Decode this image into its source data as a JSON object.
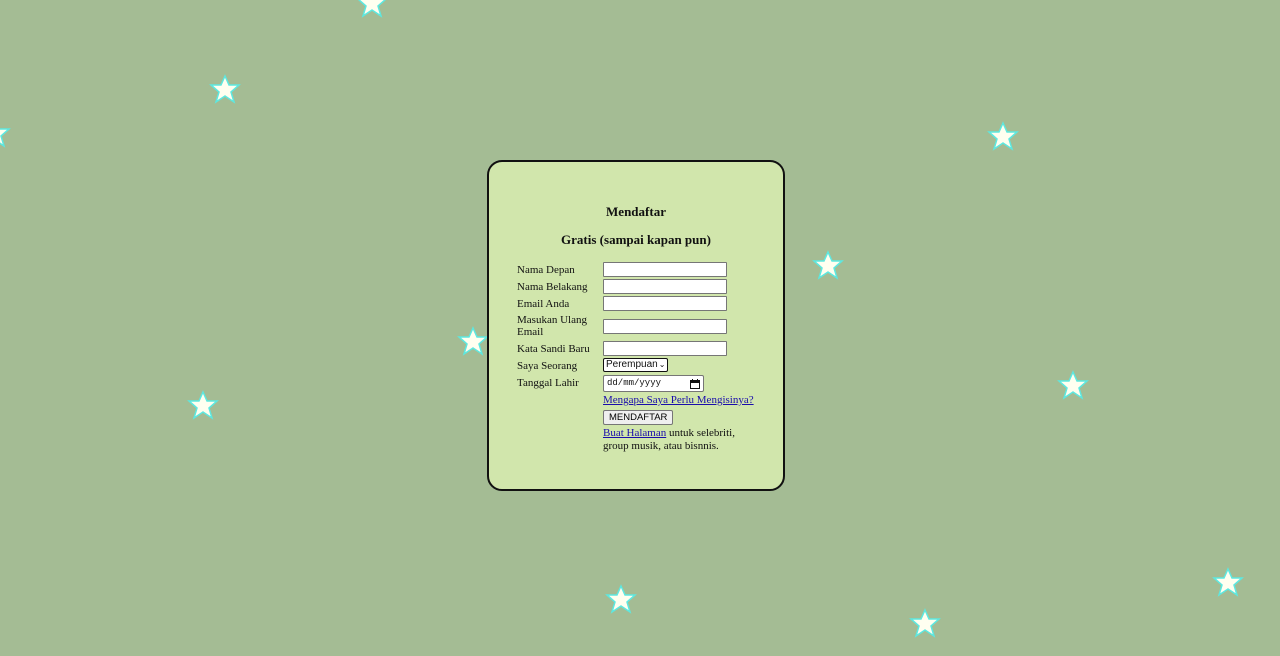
{
  "form": {
    "title": "Mendaftar",
    "subtitle": "Gratis (sampai kapan pun)",
    "fields": {
      "first_name": {
        "label": "Nama Depan",
        "value": ""
      },
      "last_name": {
        "label": "Nama Belakang",
        "value": ""
      },
      "email": {
        "label": "Email Anda",
        "value": ""
      },
      "email_confirm": {
        "label": "Masukan Ulang Email",
        "value": ""
      },
      "password": {
        "label": "Kata Sandi Baru",
        "value": ""
      },
      "gender": {
        "label": "Saya Seorang",
        "value": "Perempuan"
      },
      "birthdate": {
        "label": "Tanggal Lahir",
        "placeholder": "dd/mm/yyyy"
      }
    },
    "why_link": "Mengapa Saya Perlu Mengisinya?",
    "submit_label": "MENDAFTAR",
    "create_page_link": "Buat Halaman",
    "create_page_text": " untuk selebriti, group musik, atau bisnnis."
  },
  "background": {
    "color": "#a4bc94",
    "decoration_icon": "star-icon"
  },
  "colors": {
    "card_background": "#d1e6ac",
    "link": "#1a0dab"
  }
}
